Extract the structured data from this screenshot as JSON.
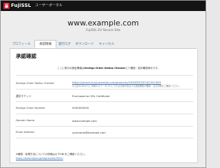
{
  "brand": {
    "logo_text": "FujiSSL",
    "portal_label": "ユーザーポータル",
    "accent": "#d6202f"
  },
  "site": {
    "title": "www.example.com",
    "subtitle": "FujiSSL EV Secure Site"
  },
  "tabs": [
    {
      "label": "プロフィール"
    },
    {
      "label": "承認情報"
    },
    {
      "label": "発行ログ"
    },
    {
      "label": "ダウンロード"
    },
    {
      "label": "キャンセル"
    }
  ],
  "panel": {
    "title": "承認確認",
    "intro_prefix": "ここに表示の認証情報は",
    "intro_bold": "Sectigo Order Status Checker",
    "intro_suffix": "にて確認・並存確認済みです。",
    "rows": [
      {
        "label": "Sectigo Order Status Checker",
        "value": "https://secure.trust-provider.com/products/!ORDERSTATUSCHECKER",
        "note": "※上記のURLからご利用のステータスもとでの注文者が担当する認証確認の確認・注文状態をご確認ください。"
      },
      {
        "label": "選択チケット",
        "value": "Purchased an SSL Certificate"
      },
      {
        "label": "Sectigo Order Number",
        "value": "0000000000"
      },
      {
        "label": "Domain Name",
        "value": "www.example.com"
      },
      {
        "label": "Email Address",
        "value": "yourname@example.com"
      }
    ],
    "footer_note": "※確認・処理方法についての詳細は以下URLをご確認ください。",
    "footer_link": "https://www.fujissl.jp/faq/review/3531/"
  }
}
